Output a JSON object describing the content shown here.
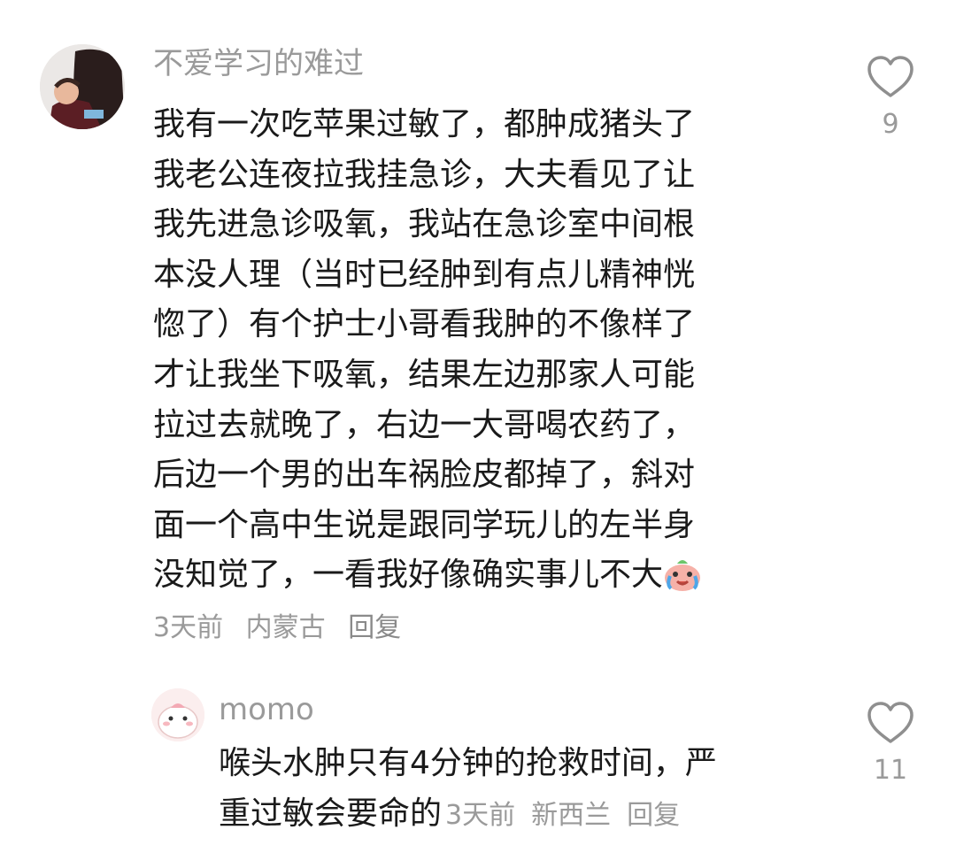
{
  "comments": [
    {
      "username": "不爱学习的难过",
      "lines": [
        "我有一次吃苹果过敏了，都肿成猪头了",
        "我老公连夜拉我挂急诊，大夫看见了让",
        "我先进急诊吸氧，我站在急诊室中间根",
        "本没人理（当时已经肿到有点儿精神恍",
        "惚了）有个护士小哥看我肿的不像样了",
        "才让我坐下吸氧，结果左边那家人可能",
        "拉过去就晚了，右边一大哥喝农药了，",
        "后边一个男的出车祸脸皮都掉了，斜对",
        "面一个高中生说是跟同学玩儿的左半身",
        "没知觉了，一看我好像确实事儿不大"
      ],
      "time": "3天前",
      "location": "内蒙古",
      "reply_label": "回复",
      "like_count": "9"
    },
    {
      "username": "momo",
      "lines": [
        "喉头水肿只有4分钟的抢救时间，严",
        "重过敏会要命的"
      ],
      "time": "3天前",
      "location": "新西兰",
      "reply_label": "回复",
      "like_count": "11"
    }
  ],
  "icons": {
    "like": "heart-outline-icon",
    "emoji": "crying-face-emoji"
  },
  "colors": {
    "text": "#1a1a1a",
    "meta": "#9a9a9a",
    "background": "#ffffff"
  }
}
